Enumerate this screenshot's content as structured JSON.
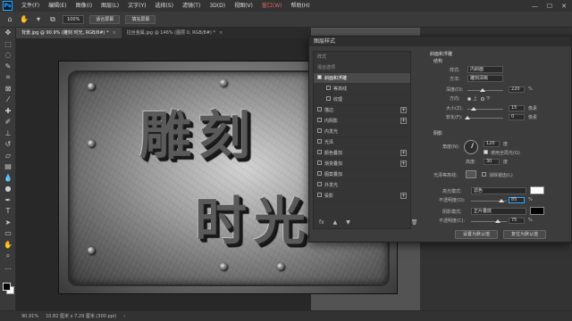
{
  "menubar": {
    "logo": "Ps",
    "items": [
      "文件(F)",
      "编辑(E)",
      "图像(I)",
      "图层(L)",
      "文字(Y)",
      "选择(S)",
      "滤镜(T)",
      "3D(D)",
      "视图(V)",
      "窗口(W)",
      "帮助(H)"
    ],
    "window_buttons": [
      "—",
      "☐",
      "✕"
    ]
  },
  "optbar": {
    "zoom": "100%",
    "fit_screen": "适合屏幕",
    "fill_screen": "填充屏幕"
  },
  "tabs": [
    {
      "label": "背景.jpg @ 90.9% (雕刻 时光, RGB/8#) *"
    },
    {
      "label": "拉丝金属.jpg @ 146% (图层 0, RGB/8#) *"
    }
  ],
  "canvas": {
    "line1": "雕刻",
    "line2": "时光"
  },
  "statusbar": {
    "zoom": "90.91%",
    "doc_size": "10.82 厘米 x 7.29 厘米 (300 ppi)"
  },
  "dialog": {
    "title": "图层样式",
    "styles": [
      {
        "label": "样式",
        "type": "header"
      },
      {
        "label": "混合选项",
        "type": "header"
      },
      {
        "label": "斜面和浮雕",
        "checked": true,
        "selected": true
      },
      {
        "label": "等高线",
        "sub": true,
        "checked": false
      },
      {
        "label": "纹理",
        "sub": true,
        "checked": false
      },
      {
        "label": "描边",
        "checked": false,
        "plus": true
      },
      {
        "label": "内阴影",
        "checked": false,
        "plus": true
      },
      {
        "label": "内发光",
        "checked": false
      },
      {
        "label": "光泽",
        "checked": false
      },
      {
        "label": "颜色叠加",
        "checked": false,
        "plus": true
      },
      {
        "label": "渐变叠加",
        "checked": false,
        "plus": true
      },
      {
        "label": "图案叠加",
        "checked": false
      },
      {
        "label": "外发光",
        "checked": false
      },
      {
        "label": "投影",
        "checked": false,
        "plus": true
      }
    ],
    "footer_icons": [
      "fx",
      "▲",
      "▼",
      "🗑"
    ],
    "bevel": {
      "section_title": "斜面和浮雕",
      "structure_title": "结构",
      "style_label": "样式:",
      "style_value": "内斜面",
      "technique_label": "方法:",
      "technique_value": "雕刻清晰",
      "depth_label": "深度(D):",
      "depth_value": "220",
      "depth_unit": "%",
      "direction_label": "方向:",
      "direction_up": "上",
      "direction_down": "下",
      "size_label": "大小(Z):",
      "size_value": "15",
      "size_unit": "像素",
      "soften_label": "软化(F):",
      "soften_value": "0",
      "soften_unit": "像素"
    },
    "shading": {
      "section_title": "阴影",
      "angle_label": "角度(N):",
      "angle_value": "120",
      "angle_unit": "度",
      "global_light": "使用全局光(G)",
      "altitude_label": "高度:",
      "altitude_value": "30",
      "altitude_unit": "度",
      "gloss_label": "光泽等高线:",
      "antialias": "消除锯齿(L)",
      "highlight_mode_label": "高光模式:",
      "highlight_mode_value": "滤色",
      "highlight_opacity_label": "不透明度(O):",
      "highlight_opacity_value": "85",
      "highlight_color": "#ffffff",
      "shadow_mode_label": "阴影模式:",
      "shadow_mode_value": "正片叠底",
      "shadow_opacity_label": "不透明度(C):",
      "shadow_opacity_value": "75",
      "shadow_color": "#000000",
      "opacity_unit": "%"
    },
    "buttons": {
      "set_default": "设置为默认值",
      "reset_default": "复位为默认值"
    }
  }
}
